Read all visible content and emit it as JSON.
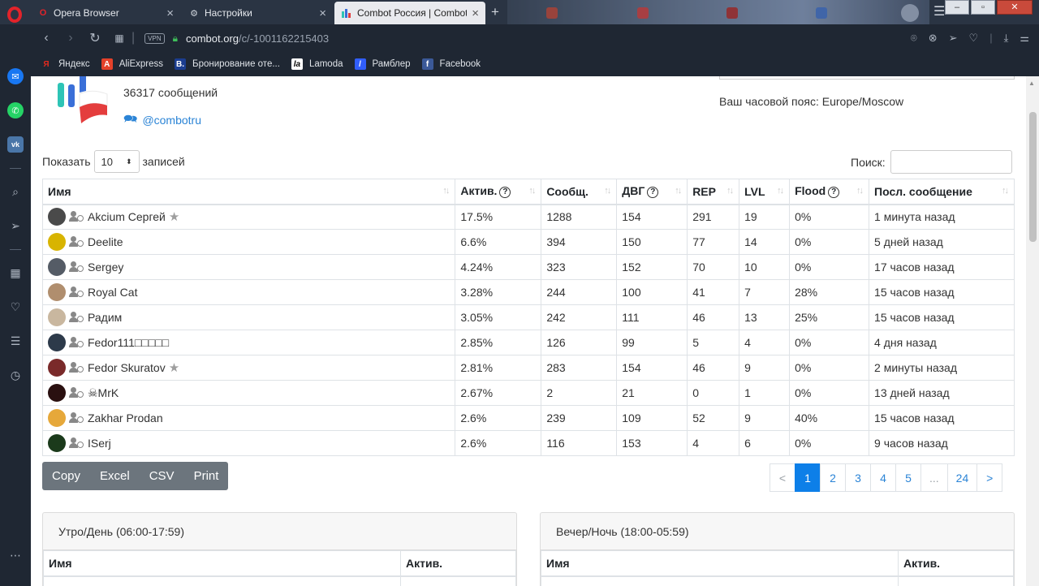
{
  "browser": {
    "tabs": [
      {
        "label": "Opera Browser"
      },
      {
        "label": "Настройки"
      },
      {
        "label": "Combot Россия | Combot"
      }
    ],
    "url_host": "combot.org",
    "url_path": "/c/-1001162215403",
    "vpn_label": "VPN",
    "bookmarks": [
      {
        "label": "Яндекс",
        "icon": "Я",
        "color": "#e32a1e"
      },
      {
        "label": "AliExpress",
        "icon": "A",
        "color": "#e4412a"
      },
      {
        "label": "Бронирование оте...",
        "icon": "B.",
        "color": "#1b3d8f"
      },
      {
        "label": "Lamoda",
        "icon": "la",
        "color": "#000000"
      },
      {
        "label": "Рамблер",
        "icon": "/",
        "color": "#315efb"
      },
      {
        "label": "Facebook",
        "icon": "f",
        "color": "#3b5998"
      }
    ]
  },
  "header": {
    "message_count": "36317 сообщений",
    "chat_handle": "@combotru",
    "timezone": "Ваш часовой пояс: Europe/Moscow"
  },
  "controls": {
    "show_label": "Показать",
    "page_size": "10",
    "entries_label": "записей",
    "search_label": "Поиск:"
  },
  "table": {
    "columns": [
      "Имя",
      "Актив.",
      "Сообщ.",
      "ДВГ",
      "REP",
      "LVL",
      "Flood",
      "Посл. сообщение"
    ],
    "rows": [
      {
        "name": "Akcium Сергей",
        "star": true,
        "activity": "17.5%",
        "messages": "1288",
        "dvg": "154",
        "rep": "291",
        "lvl": "19",
        "flood": "0%",
        "flood_warn": false,
        "last": "1 минута назад",
        "avatar": "#4a4a4a"
      },
      {
        "name": "Deelite",
        "star": false,
        "activity": "6.6%",
        "messages": "394",
        "dvg": "150",
        "rep": "77",
        "lvl": "14",
        "flood": "0%",
        "flood_warn": false,
        "last": "5 дней назад",
        "avatar": "#d8b400"
      },
      {
        "name": "Sergey",
        "star": false,
        "activity": "4.24%",
        "messages": "323",
        "dvg": "152",
        "rep": "70",
        "lvl": "10",
        "flood": "0%",
        "flood_warn": false,
        "last": "17 часов назад",
        "avatar": "#555c66"
      },
      {
        "name": "Royal Cat",
        "star": false,
        "activity": "3.28%",
        "messages": "244",
        "dvg": "100",
        "rep": "41",
        "lvl": "7",
        "flood": "28%",
        "flood_warn": true,
        "last": "15 часов назад",
        "avatar": "#b08e6e"
      },
      {
        "name": "Радим",
        "star": false,
        "activity": "3.05%",
        "messages": "242",
        "dvg": "111",
        "rep": "46",
        "lvl": "13",
        "flood": "25%",
        "flood_warn": true,
        "last": "15 часов назад",
        "avatar": "#c9b79f"
      },
      {
        "name": "Fedor111□□□□□",
        "star": false,
        "activity": "2.85%",
        "messages": "126",
        "dvg": "99",
        "rep": "5",
        "lvl": "4",
        "flood": "0%",
        "flood_warn": false,
        "last": "4 дня назад",
        "avatar": "#2d3a4a"
      },
      {
        "name": "Fedor Skuratov",
        "star": true,
        "activity": "2.81%",
        "messages": "283",
        "dvg": "154",
        "rep": "46",
        "lvl": "9",
        "flood": "0%",
        "flood_warn": false,
        "last": "2 минуты назад",
        "avatar": "#7a2a2a"
      },
      {
        "name": "☠MrK",
        "star": false,
        "activity": "2.67%",
        "messages": "2",
        "dvg": "21",
        "rep": "0",
        "lvl": "1",
        "flood": "0%",
        "flood_warn": false,
        "last": "13 дней назад",
        "avatar": "#2a1010"
      },
      {
        "name": "Zakhar Prodan",
        "star": false,
        "activity": "2.6%",
        "messages": "239",
        "dvg": "109",
        "rep": "52",
        "lvl": "9",
        "flood": "40%",
        "flood_warn": true,
        "last": "15 часов назад",
        "avatar": "#e6a83a"
      },
      {
        "name": "ISerj",
        "star": false,
        "activity": "2.6%",
        "messages": "116",
        "dvg": "153",
        "rep": "4",
        "lvl": "6",
        "flood": "0%",
        "flood_warn": false,
        "last": "9 часов назад",
        "avatar": "#1b3a1b"
      }
    ],
    "warn_color": "#f0b73f"
  },
  "export_buttons": [
    "Copy",
    "Excel",
    "CSV",
    "Print"
  ],
  "pagination": {
    "prev": "<",
    "pages": [
      "1",
      "2",
      "3",
      "4",
      "5",
      "...",
      "24"
    ],
    "active": "1",
    "next": ">"
  },
  "cards": [
    {
      "title": "Утро/День (06:00-17:59)",
      "col_name": "Имя",
      "col_activity": "Актив."
    },
    {
      "title": "Вечер/Ночь (18:00-05:59)",
      "col_name": "Имя",
      "col_activity": "Актив."
    }
  ]
}
